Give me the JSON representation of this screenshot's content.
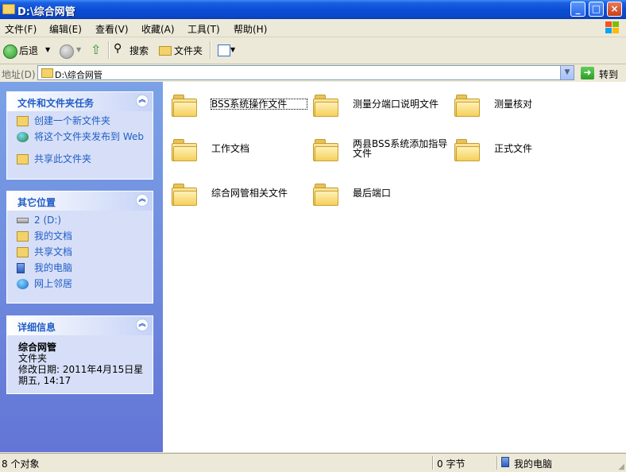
{
  "window": {
    "title": "D:\\综合网管"
  },
  "menu": [
    "文件(F)",
    "编辑(E)",
    "查看(V)",
    "收藏(A)",
    "工具(T)",
    "帮助(H)"
  ],
  "toolbar": {
    "back": "后退",
    "search": "搜索",
    "folders": "文件夹"
  },
  "address": {
    "label": "地址(D)",
    "value": "D:\\综合网管",
    "go": "转到"
  },
  "tasks_panel": {
    "title": "文件和文件夹任务",
    "items": [
      "创建一个新文件夹",
      "将这个文件夹发布到 Web",
      "共享此文件夹"
    ]
  },
  "places_panel": {
    "title": "其它位置",
    "items": [
      "2 (D:)",
      "我的文档",
      "共享文档",
      "我的电脑",
      "网上邻居"
    ]
  },
  "details_panel": {
    "title": "详细信息",
    "name": "综合网管",
    "type": "文件夹",
    "modified": "修改日期: 2011年4月15日星期五, 14:17"
  },
  "files": [
    "BSS系统操作文件",
    "测量分端口说明文件",
    "测量核对",
    "工作文档",
    "两县BSS系统添加指导文件",
    "正式文件",
    "综合网管相关文件",
    "最后端口"
  ],
  "status": {
    "objects": "8 个对象",
    "size": "0 字节",
    "location": "我的电脑"
  },
  "colors": {
    "title_blue": "#0a4ed6",
    "task_blue": "#215dc6",
    "panel_bg": "#d6dff7"
  }
}
